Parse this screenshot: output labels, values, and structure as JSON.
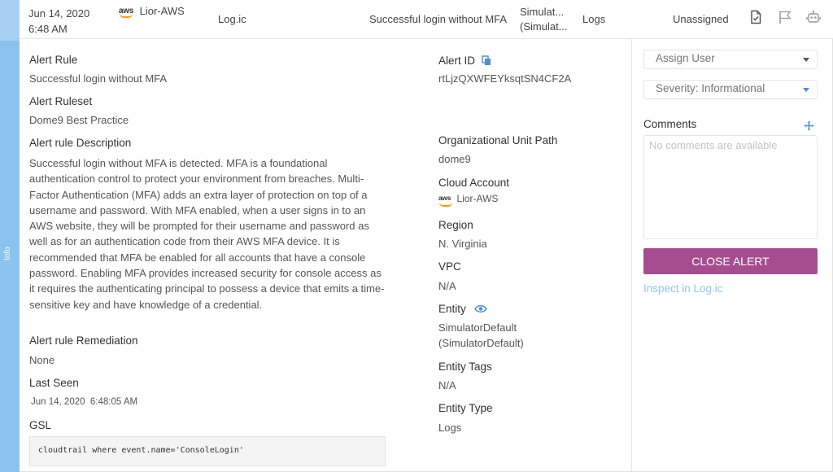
{
  "sidebar": {
    "tab_label": "Info"
  },
  "header": {
    "date": "Jun 14, 2020",
    "time": "6:48 AM",
    "account_logo": "aws",
    "account": "Lior-AWS",
    "source": "Log.ic",
    "rule": "Successful login without MFA",
    "entity_line1": "Simulat...",
    "entity_line2": "(Simulat...",
    "entity_type": "Logs",
    "assignee": "Unassigned",
    "icons": [
      "report-check-icon",
      "flag-icon",
      "robot-icon"
    ]
  },
  "details": {
    "alert_rule_label": "Alert Rule",
    "alert_rule": "Successful login without MFA",
    "ruleset_label": "Alert Ruleset",
    "ruleset": "Dome9 Best Practice",
    "description_label": "Alert rule Description",
    "description": "Successful login without MFA is detected. MFA is a foundational authentication control to protect your environment from breaches. Multi-Factor Authentication (MFA) adds an extra layer of protection on top of a username and password. With MFA enabled, when a user signs in to an AWS website, they will be prompted for their username and password as well as for an authentication code from their AWS MFA device. It is recommended that MFA be enabled for all accounts that have a console password. Enabling MFA provides increased security for console access as it requires the authenticating principal to possess a device that emits a time-sensitive key and have knowledge of a credential.",
    "remediation_label": "Alert rule Remediation",
    "remediation": "None",
    "last_seen_label": "Last Seen",
    "last_seen": "Jun 14, 2020  6:48:05 AM",
    "gsl_label": "GSL",
    "gsl": "cloudtrail where event.name='ConsoleLogin'"
  },
  "meta": {
    "alert_id_label": "Alert ID",
    "alert_id": "rtLjzQXWFEYksqtSN4CF2A",
    "ou_path_label": "Organizational Unit Path",
    "ou_path": "dome9",
    "cloud_account_label": "Cloud Account",
    "cloud_account_logo": "aws",
    "cloud_account": "Lior-AWS",
    "region_label": "Region",
    "region": "N. Virginia",
    "vpc_label": "VPC",
    "vpc": "N/A",
    "entity_label": "Entity",
    "entity_line1": "SimulatorDefault",
    "entity_line2": "(SimulatorDefault)",
    "entity_tags_label": "Entity Tags",
    "entity_tags": "N/A",
    "entity_type_label": "Entity Type",
    "entity_type": "Logs"
  },
  "actions": {
    "assign_user": "Assign User",
    "severity": "Severity: Informational",
    "comments_label": "Comments",
    "comments_placeholder": "No comments are available",
    "close_alert": "CLOSE ALERT",
    "inspect_link": "Inspect in Log.ic"
  },
  "colors": {
    "sidebar": "#a6cff2",
    "close_button": "#a64d8f",
    "link": "#8cc7ec",
    "accent_icon": "#4a90d9"
  }
}
